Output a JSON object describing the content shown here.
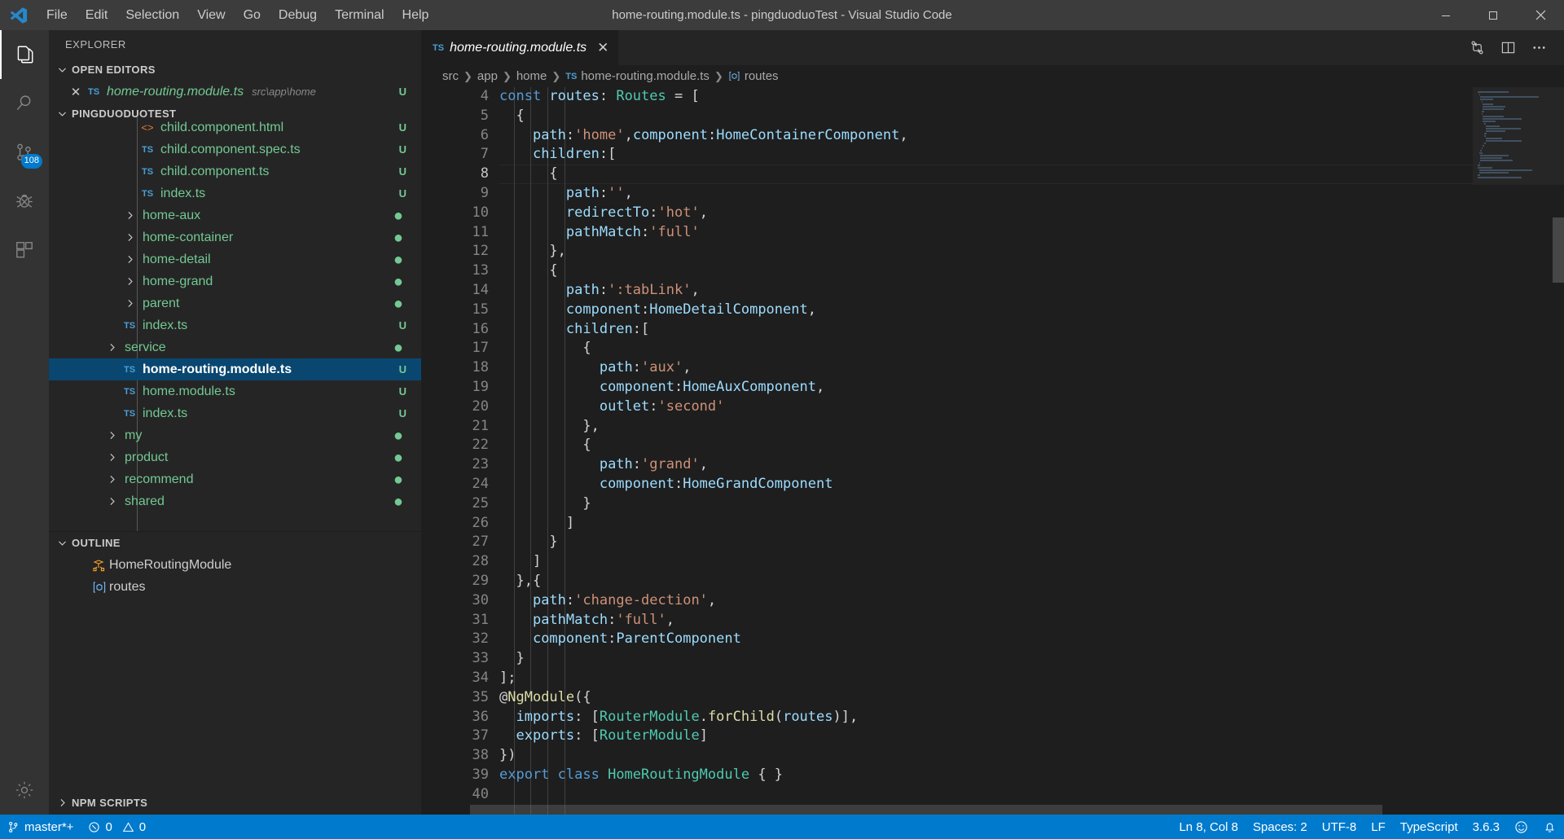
{
  "titlebar": {
    "title": "home-routing.module.ts - pingduoduoTest - Visual Studio Code",
    "menus": [
      {
        "label": "File"
      },
      {
        "label": "Edit"
      },
      {
        "label": "Selection"
      },
      {
        "label": "View"
      },
      {
        "label": "Go"
      },
      {
        "label": "Debug"
      },
      {
        "label": "Terminal"
      },
      {
        "label": "Help"
      }
    ],
    "window_controls": {
      "minimize": "─",
      "maximize": "❐",
      "close": "✕"
    }
  },
  "activitybar": {
    "items": [
      {
        "name": "explorer",
        "icon": "files-icon",
        "active": true,
        "badge": ""
      },
      {
        "name": "search",
        "icon": "search-icon",
        "active": false,
        "badge": ""
      },
      {
        "name": "source-control",
        "icon": "source-control-icon",
        "active": false,
        "badge": "108"
      },
      {
        "name": "debug",
        "icon": "debug-icon",
        "active": false,
        "badge": ""
      },
      {
        "name": "extensions",
        "icon": "extensions-icon",
        "active": false,
        "badge": ""
      }
    ],
    "bottom": [
      {
        "name": "manage",
        "icon": "gear-icon"
      }
    ]
  },
  "sidebar": {
    "title": "EXPLORER",
    "open_editors": {
      "header": "OPEN EDITORS",
      "items": [
        {
          "close": "✕",
          "badge": "TS",
          "label": "home-routing.module.ts",
          "path": "src\\app\\home",
          "git": "U"
        }
      ]
    },
    "project": {
      "header": "PINGDUODUOTEST",
      "items": [
        {
          "type": "file",
          "badge": "html",
          "label": "child.component.html",
          "git": "U",
          "indent": 4,
          "selected": false
        },
        {
          "type": "file",
          "badge": "TS",
          "label": "child.component.spec.ts",
          "git": "U",
          "indent": 4,
          "selected": false
        },
        {
          "type": "file",
          "badge": "TS",
          "label": "child.component.ts",
          "git": "U",
          "indent": 4,
          "selected": false
        },
        {
          "type": "file",
          "badge": "TS",
          "label": "index.ts",
          "git": "U",
          "indent": 4,
          "selected": false
        },
        {
          "type": "folder",
          "label": "home-aux",
          "git": "dot",
          "indent": 3,
          "selected": false
        },
        {
          "type": "folder",
          "label": "home-container",
          "git": "dot",
          "indent": 3,
          "selected": false
        },
        {
          "type": "folder",
          "label": "home-detail",
          "git": "dot",
          "indent": 3,
          "selected": false
        },
        {
          "type": "folder",
          "label": "home-grand",
          "git": "dot",
          "indent": 3,
          "selected": false
        },
        {
          "type": "folder",
          "label": "parent",
          "git": "dot",
          "indent": 3,
          "selected": false
        },
        {
          "type": "file",
          "badge": "TS",
          "label": "index.ts",
          "git": "U",
          "indent": 3,
          "selected": false
        },
        {
          "type": "folder",
          "label": "service",
          "git": "dot",
          "indent": 2,
          "selected": false
        },
        {
          "type": "file",
          "badge": "TS",
          "label": "home-routing.module.ts",
          "git": "U",
          "indent": 3,
          "selected": true
        },
        {
          "type": "file",
          "badge": "TS",
          "label": "home.module.ts",
          "git": "U",
          "indent": 3,
          "selected": false
        },
        {
          "type": "file",
          "badge": "TS",
          "label": "index.ts",
          "git": "U",
          "indent": 3,
          "selected": false
        },
        {
          "type": "folder",
          "label": "my",
          "git": "dot",
          "indent": 2,
          "selected": false
        },
        {
          "type": "folder",
          "label": "product",
          "git": "dot",
          "indent": 2,
          "selected": false
        },
        {
          "type": "folder",
          "label": "recommend",
          "git": "dot",
          "indent": 2,
          "selected": false
        },
        {
          "type": "folder",
          "label": "shared",
          "git": "dot",
          "indent": 2,
          "selected": false
        }
      ]
    },
    "outline": {
      "header": "OUTLINE",
      "items": [
        {
          "icon": "class-symbol-icon",
          "label": "HomeRoutingModule"
        },
        {
          "icon": "variable-symbol-icon",
          "label": "routes"
        }
      ]
    },
    "npm_scripts": {
      "header": "NPM SCRIPTS"
    }
  },
  "editor": {
    "tab": {
      "badge": "TS",
      "label": "home-routing.module.ts",
      "close": "✕"
    },
    "tab_actions": [
      {
        "name": "split-editor-icon"
      },
      {
        "name": "more-actions-icon"
      }
    ],
    "breadcrumbs": [
      {
        "label": "src",
        "icon": ""
      },
      {
        "label": "app",
        "icon": ""
      },
      {
        "label": "home",
        "icon": ""
      },
      {
        "label": "home-routing.module.ts",
        "icon": "TS"
      },
      {
        "label": "routes",
        "icon": "variable-symbol-icon"
      }
    ],
    "first_line_number": 4,
    "cursor_line": 8,
    "lines": [
      {
        "n": 4,
        "tokens": [
          {
            "t": "const ",
            "c": "k"
          },
          {
            "t": "routes",
            "c": "v"
          },
          {
            "t": ": ",
            "c": "p"
          },
          {
            "t": "Routes",
            "c": "t"
          },
          {
            "t": " = ",
            "c": "p"
          },
          {
            "t": "[",
            "c": "p"
          }
        ]
      },
      {
        "n": 5,
        "tokens": [
          {
            "t": "  {",
            "c": "p"
          }
        ]
      },
      {
        "n": 6,
        "tokens": [
          {
            "t": "    ",
            "c": "p"
          },
          {
            "t": "path",
            "c": "v"
          },
          {
            "t": ":",
            "c": "p"
          },
          {
            "t": "'home'",
            "c": "s"
          },
          {
            "t": ",",
            "c": "p"
          },
          {
            "t": "component",
            "c": "v"
          },
          {
            "t": ":",
            "c": "p"
          },
          {
            "t": "HomeContainerComponent",
            "c": "v"
          },
          {
            "t": ",",
            "c": "p"
          }
        ]
      },
      {
        "n": 7,
        "tokens": [
          {
            "t": "    ",
            "c": "p"
          },
          {
            "t": "children",
            "c": "v"
          },
          {
            "t": ":",
            "c": "p"
          },
          {
            "t": "[",
            "c": "p"
          }
        ]
      },
      {
        "n": 8,
        "tokens": [
          {
            "t": "      {",
            "c": "p"
          }
        ]
      },
      {
        "n": 9,
        "tokens": [
          {
            "t": "        ",
            "c": "p"
          },
          {
            "t": "path",
            "c": "v"
          },
          {
            "t": ":",
            "c": "p"
          },
          {
            "t": "''",
            "c": "s"
          },
          {
            "t": ",",
            "c": "p"
          }
        ]
      },
      {
        "n": 10,
        "tokens": [
          {
            "t": "        ",
            "c": "p"
          },
          {
            "t": "redirectTo",
            "c": "v"
          },
          {
            "t": ":",
            "c": "p"
          },
          {
            "t": "'hot'",
            "c": "s"
          },
          {
            "t": ",",
            "c": "p"
          }
        ]
      },
      {
        "n": 11,
        "tokens": [
          {
            "t": "        ",
            "c": "p"
          },
          {
            "t": "pathMatch",
            "c": "v"
          },
          {
            "t": ":",
            "c": "p"
          },
          {
            "t": "'full'",
            "c": "s"
          }
        ]
      },
      {
        "n": 12,
        "tokens": [
          {
            "t": "      },",
            "c": "p"
          }
        ]
      },
      {
        "n": 13,
        "tokens": [
          {
            "t": "      {",
            "c": "p"
          }
        ]
      },
      {
        "n": 14,
        "tokens": [
          {
            "t": "        ",
            "c": "p"
          },
          {
            "t": "path",
            "c": "v"
          },
          {
            "t": ":",
            "c": "p"
          },
          {
            "t": "':tabLink'",
            "c": "s"
          },
          {
            "t": ",",
            "c": "p"
          }
        ]
      },
      {
        "n": 15,
        "tokens": [
          {
            "t": "        ",
            "c": "p"
          },
          {
            "t": "component",
            "c": "v"
          },
          {
            "t": ":",
            "c": "p"
          },
          {
            "t": "HomeDetailComponent",
            "c": "v"
          },
          {
            "t": ",",
            "c": "p"
          }
        ]
      },
      {
        "n": 16,
        "tokens": [
          {
            "t": "        ",
            "c": "p"
          },
          {
            "t": "children",
            "c": "v"
          },
          {
            "t": ":",
            "c": "p"
          },
          {
            "t": "[",
            "c": "p"
          }
        ]
      },
      {
        "n": 17,
        "tokens": [
          {
            "t": "          {",
            "c": "p"
          }
        ]
      },
      {
        "n": 18,
        "tokens": [
          {
            "t": "            ",
            "c": "p"
          },
          {
            "t": "path",
            "c": "v"
          },
          {
            "t": ":",
            "c": "p"
          },
          {
            "t": "'aux'",
            "c": "s"
          },
          {
            "t": ",",
            "c": "p"
          }
        ]
      },
      {
        "n": 19,
        "tokens": [
          {
            "t": "            ",
            "c": "p"
          },
          {
            "t": "component",
            "c": "v"
          },
          {
            "t": ":",
            "c": "p"
          },
          {
            "t": "HomeAuxComponent",
            "c": "v"
          },
          {
            "t": ",",
            "c": "p"
          }
        ]
      },
      {
        "n": 20,
        "tokens": [
          {
            "t": "            ",
            "c": "p"
          },
          {
            "t": "outlet",
            "c": "v"
          },
          {
            "t": ":",
            "c": "p"
          },
          {
            "t": "'second'",
            "c": "s"
          }
        ]
      },
      {
        "n": 21,
        "tokens": [
          {
            "t": "          },",
            "c": "p"
          }
        ]
      },
      {
        "n": 22,
        "tokens": [
          {
            "t": "          {",
            "c": "p"
          }
        ]
      },
      {
        "n": 23,
        "tokens": [
          {
            "t": "            ",
            "c": "p"
          },
          {
            "t": "path",
            "c": "v"
          },
          {
            "t": ":",
            "c": "p"
          },
          {
            "t": "'grand'",
            "c": "s"
          },
          {
            "t": ",",
            "c": "p"
          }
        ]
      },
      {
        "n": 24,
        "tokens": [
          {
            "t": "            ",
            "c": "p"
          },
          {
            "t": "component",
            "c": "v"
          },
          {
            "t": ":",
            "c": "p"
          },
          {
            "t": "HomeGrandComponent",
            "c": "v"
          }
        ]
      },
      {
        "n": 25,
        "tokens": [
          {
            "t": "          }",
            "c": "p"
          }
        ]
      },
      {
        "n": 26,
        "tokens": [
          {
            "t": "        ]",
            "c": "p"
          }
        ]
      },
      {
        "n": 27,
        "tokens": [
          {
            "t": "      }",
            "c": "p"
          }
        ]
      },
      {
        "n": 28,
        "tokens": [
          {
            "t": "    ]",
            "c": "p"
          }
        ]
      },
      {
        "n": 29,
        "tokens": [
          {
            "t": "  },{",
            "c": "p"
          }
        ]
      },
      {
        "n": 30,
        "tokens": [
          {
            "t": "    ",
            "c": "p"
          },
          {
            "t": "path",
            "c": "v"
          },
          {
            "t": ":",
            "c": "p"
          },
          {
            "t": "'change-dection'",
            "c": "s"
          },
          {
            "t": ",",
            "c": "p"
          }
        ]
      },
      {
        "n": 31,
        "tokens": [
          {
            "t": "    ",
            "c": "p"
          },
          {
            "t": "pathMatch",
            "c": "v"
          },
          {
            "t": ":",
            "c": "p"
          },
          {
            "t": "'full'",
            "c": "s"
          },
          {
            "t": ",",
            "c": "p"
          }
        ]
      },
      {
        "n": 32,
        "tokens": [
          {
            "t": "    ",
            "c": "p"
          },
          {
            "t": "component",
            "c": "v"
          },
          {
            "t": ":",
            "c": "p"
          },
          {
            "t": "ParentComponent",
            "c": "v"
          }
        ]
      },
      {
        "n": 33,
        "tokens": [
          {
            "t": "  }",
            "c": "p"
          }
        ]
      },
      {
        "n": 34,
        "tokens": [
          {
            "t": "];",
            "c": "p"
          }
        ]
      },
      {
        "n": 35,
        "tokens": [
          {
            "t": "@",
            "c": "p"
          },
          {
            "t": "NgModule",
            "c": "dec"
          },
          {
            "t": "({",
            "c": "p"
          }
        ]
      },
      {
        "n": 36,
        "tokens": [
          {
            "t": "  ",
            "c": "p"
          },
          {
            "t": "imports",
            "c": "v"
          },
          {
            "t": ": [",
            "c": "p"
          },
          {
            "t": "RouterModule",
            "c": "t"
          },
          {
            "t": ".",
            "c": "p"
          },
          {
            "t": "forChild",
            "c": "dec"
          },
          {
            "t": "(",
            "c": "p"
          },
          {
            "t": "routes",
            "c": "v"
          },
          {
            "t": ")],",
            "c": "p"
          }
        ]
      },
      {
        "n": 37,
        "tokens": [
          {
            "t": "  ",
            "c": "p"
          },
          {
            "t": "exports",
            "c": "v"
          },
          {
            "t": ": [",
            "c": "p"
          },
          {
            "t": "RouterModule",
            "c": "t"
          },
          {
            "t": "]",
            "c": "p"
          }
        ]
      },
      {
        "n": 38,
        "tokens": [
          {
            "t": "})",
            "c": "p"
          }
        ]
      },
      {
        "n": 39,
        "tokens": [
          {
            "t": "export ",
            "c": "k"
          },
          {
            "t": "class ",
            "c": "k"
          },
          {
            "t": "HomeRoutingModule",
            "c": "cls"
          },
          {
            "t": " { }",
            "c": "p"
          }
        ]
      },
      {
        "n": 40,
        "tokens": [
          {
            "t": "",
            "c": "p"
          }
        ]
      }
    ]
  },
  "statusbar": {
    "left": [
      {
        "name": "branch",
        "icon": "source-control-icon",
        "label": "master*+"
      },
      {
        "name": "problems",
        "icon": "error-warning-icon",
        "label": "0  0",
        "errors": "0",
        "warnings": "0"
      }
    ],
    "right": [
      {
        "name": "cursor-position",
        "label": "Ln 8, Col 8"
      },
      {
        "name": "indentation",
        "label": "Spaces: 2"
      },
      {
        "name": "encoding",
        "label": "UTF-8"
      },
      {
        "name": "eol",
        "label": "LF"
      },
      {
        "name": "language-mode",
        "label": "TypeScript"
      },
      {
        "name": "ts-version",
        "label": "3.6.3"
      },
      {
        "name": "feedback",
        "label": "☺"
      },
      {
        "name": "notifications",
        "label": "🔔"
      }
    ]
  },
  "colors": {
    "accent": "#007acc",
    "selection": "#094771",
    "git_green": "#73c991",
    "editor_bg": "#1e1e1e",
    "sidebar_bg": "#252526",
    "titlebar_bg": "#3c3c3c"
  }
}
